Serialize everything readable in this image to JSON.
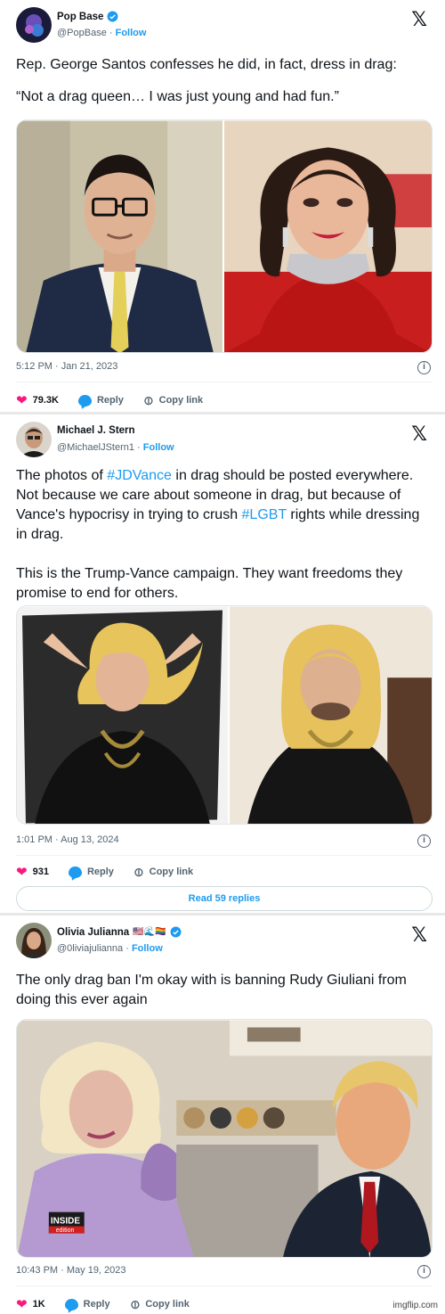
{
  "tweets": [
    {
      "name": "Pop Base",
      "handle": "@PopBase",
      "follow": "Follow",
      "text": "Rep. George Santos confesses he did, in fact, dress in drag:",
      "text2": "“Not a drag queen… I was just young and had fun.”",
      "timestamp": "5:12 PM · Jan 21, 2023",
      "likes": "79.3K",
      "reply": "Reply",
      "copy_link": "Copy link"
    },
    {
      "name": "Michael J. Stern",
      "handle": "@MichaelJStern1",
      "follow": "Follow",
      "text_a": "The photos of ",
      "tag1": "#JDVance",
      "text_b": " in drag should be posted everywhere.  Not because we care about someone in drag, but because of Vance's hypocrisy in trying to crush ",
      "tag2": "#LGBT",
      "text_c": " rights while dressing in drag.",
      "text2": "This is the Trump-Vance campaign.  They want freedoms they promise to end for others.",
      "timestamp": "1:01 PM · Aug 13, 2024",
      "likes": "931",
      "reply": "Reply",
      "copy_link": "Copy link",
      "read_replies": "Read 59 replies"
    },
    {
      "name": "Olivia Julianna",
      "name_emoji": "🇺🇸🌊🏳️‍🌈",
      "handle": "@0liviajulianna",
      "follow": "Follow",
      "text": "The only drag ban I'm okay with is banning Rudy Giuliani from doing this ever again",
      "timestamp": "10:43 PM · May 19, 2023",
      "likes": "1K",
      "reply": "Reply",
      "copy_link": "Copy link",
      "video_logo_top": "INSIDE",
      "video_logo_bottom": "edition"
    }
  ],
  "x_logo": "𝕏",
  "watermark": "imgflip.com",
  "colors": {
    "accent": "#1d9bf0",
    "like": "#f91880",
    "muted": "#536471"
  }
}
